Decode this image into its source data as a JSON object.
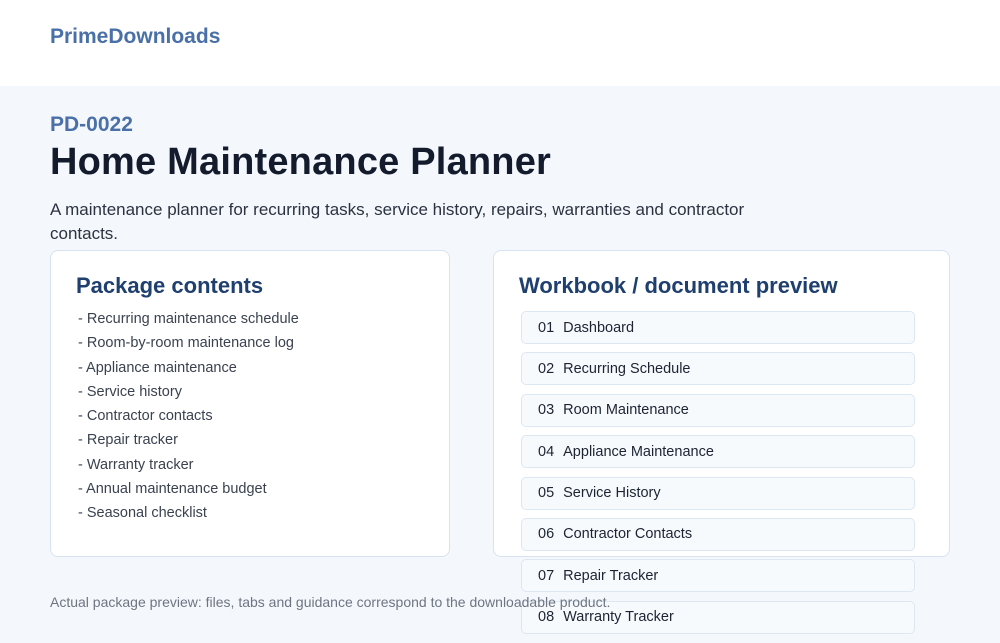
{
  "header": {
    "brand": "PrimeDownloads"
  },
  "product": {
    "code": "PD-0022",
    "title": "Home Maintenance Planner",
    "description": "A maintenance planner for recurring tasks, service history, repairs, warranties and contractor contacts."
  },
  "contents": {
    "heading": "Package contents",
    "items": [
      "- Recurring maintenance schedule",
      "- Room-by-room maintenance log",
      "- Appliance maintenance",
      "- Service history",
      "- Contractor contacts",
      "- Repair tracker",
      "- Warranty tracker",
      "- Annual maintenance budget",
      "- Seasonal checklist"
    ]
  },
  "preview": {
    "heading": "Workbook / document preview",
    "items": [
      {
        "num": "01",
        "label": "Dashboard"
      },
      {
        "num": "02",
        "label": "Recurring Schedule"
      },
      {
        "num": "03",
        "label": "Room Maintenance"
      },
      {
        "num": "04",
        "label": "Appliance Maintenance"
      },
      {
        "num": "05",
        "label": "Service History"
      },
      {
        "num": "06",
        "label": "Contractor Contacts"
      },
      {
        "num": "07",
        "label": "Repair Tracker"
      },
      {
        "num": "08",
        "label": "Warranty Tracker"
      }
    ]
  },
  "footnote": "Actual package preview: files, tabs and guidance correspond to the downloadable product."
}
